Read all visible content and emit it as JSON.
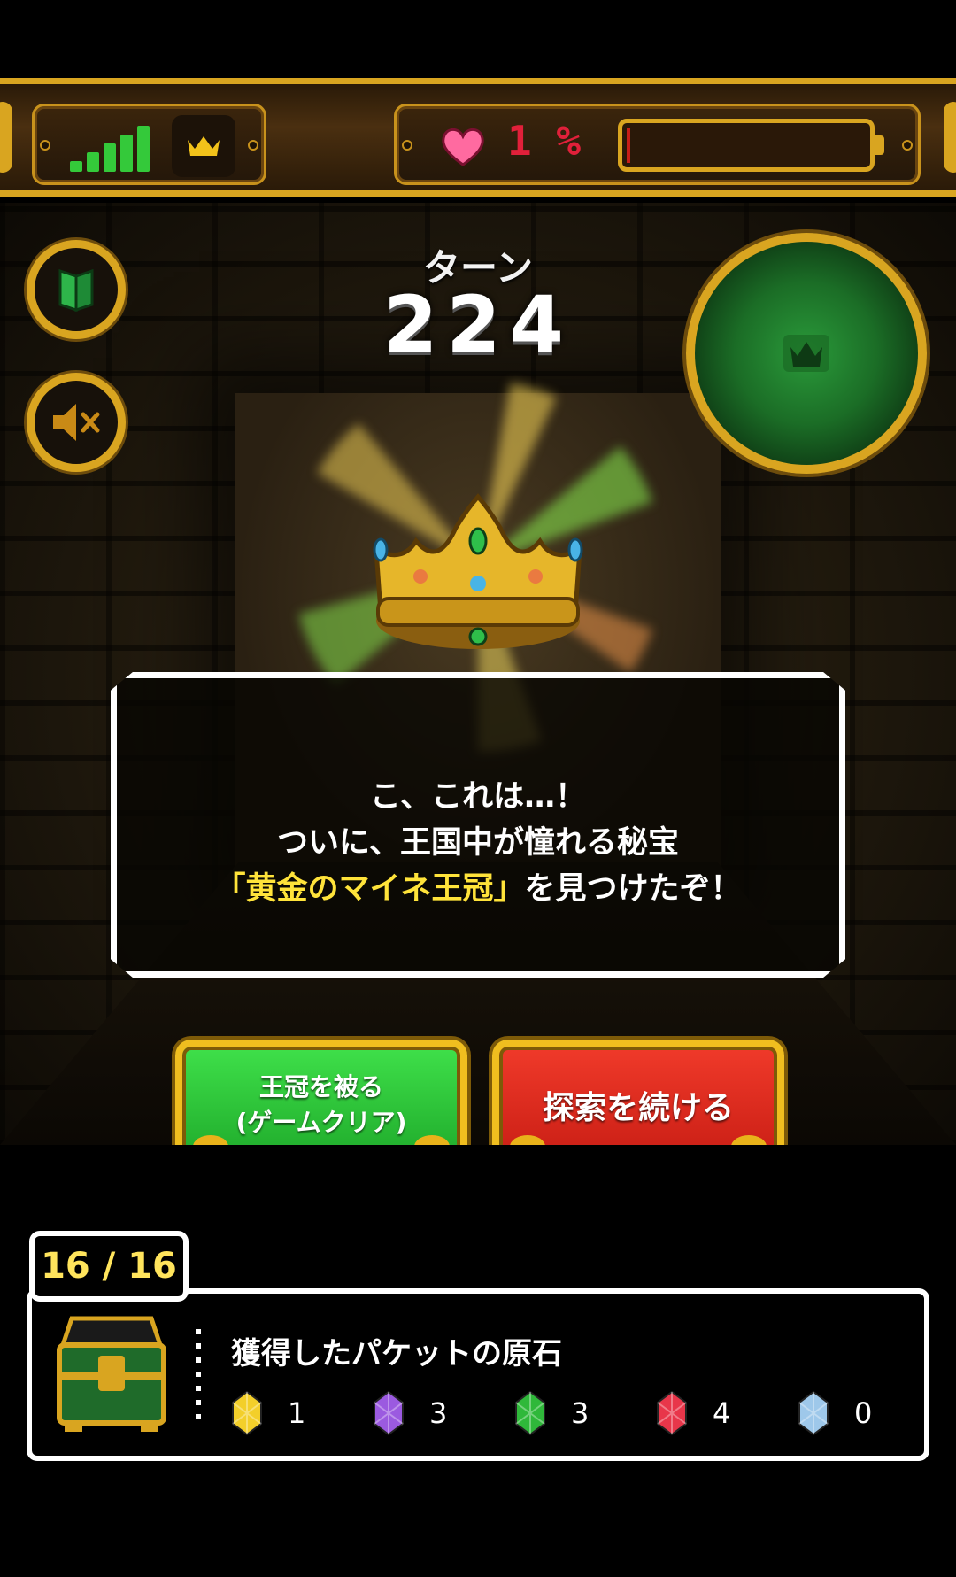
{
  "status_bar": {
    "signal_icon": "signal-bars-icon",
    "crown_icon": "crown-icon",
    "heart_icon": "heart-icon",
    "hp_text": "1 %",
    "battery_fill": 0.01,
    "colors": {
      "gold": "#d9a520",
      "hp": "#e0203a",
      "signal": "#34c93a"
    }
  },
  "controls": {
    "guide_icon": "book-icon",
    "sound_icon": "speaker-muted-icon",
    "minimap_icon": "crown-icon"
  },
  "turn": {
    "label": "ターン",
    "value": "224"
  },
  "dialog": {
    "line1": "こ、これは…！",
    "line2": "ついに、王国中が憧れる秘宝",
    "line3_highlight": "「黄金のマイネ王冠」",
    "line3_rest": "を見つけたぞ！"
  },
  "buttons": {
    "wear_line1": "王冠を被る",
    "wear_line2": "(ゲームクリア)",
    "continue_label": "探索を続ける",
    "colors": {
      "green": "#2bc236",
      "red": "#dd2a1d",
      "frame": "#f0be1f"
    }
  },
  "inventory": {
    "count": "16 / 16",
    "title": "獲得したパケットの原石",
    "gems": [
      {
        "icon": "yellow-gem-icon",
        "color": "#f3cf2a",
        "count": "1"
      },
      {
        "icon": "rainbow-gem-icon",
        "color": "#9b5ae0",
        "count": "3"
      },
      {
        "icon": "green-gem-icon",
        "color": "#2fb83a",
        "count": "3"
      },
      {
        "icon": "red-gem-icon",
        "color": "#e8364a",
        "count": "4"
      },
      {
        "icon": "blue-gem-icon",
        "color": "#9ec8ea",
        "count": "0"
      }
    ]
  }
}
